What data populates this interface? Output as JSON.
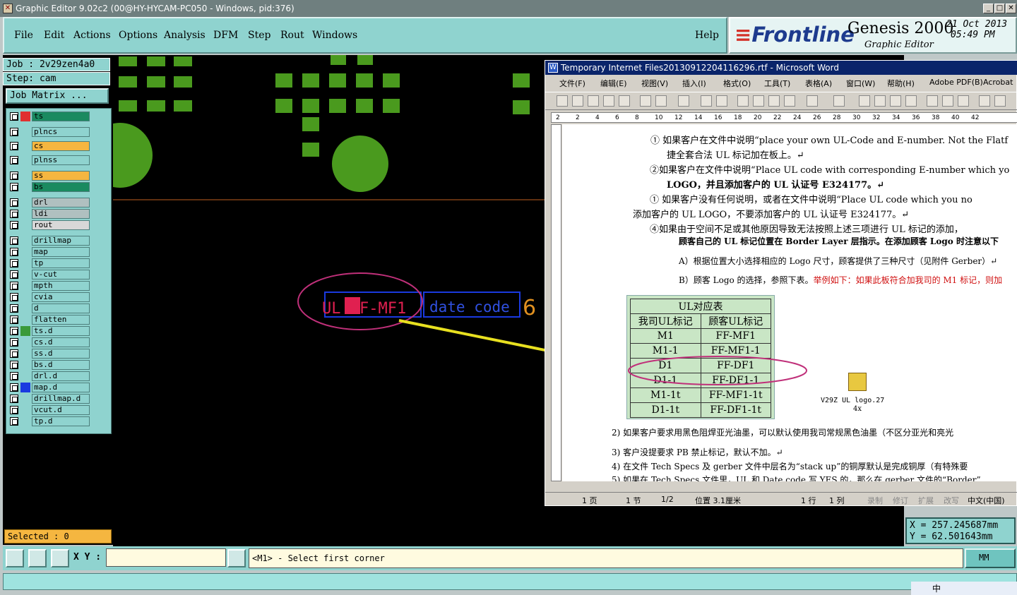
{
  "titlebar": {
    "title": "Graphic Editor 9.02c2 (00@HY-HYCAM-PC050 - Windows, pid:376)",
    "icon": "app-icon"
  },
  "menu": {
    "items": [
      "File",
      "Edit",
      "Actions",
      "Options",
      "Analysis",
      "DFM",
      "Step",
      "Rout",
      "Windows"
    ],
    "help": "Help"
  },
  "brand": {
    "logo": "Frontline",
    "product": "Genesis 2000",
    "subtitle": "Graphic Editor",
    "date": "21 Oct 2013",
    "time": "05:49 PM"
  },
  "job": {
    "job_field": "Job : 2v29zen4a0",
    "step_field": "Step: cam",
    "matrix_button": "Job Matrix ..."
  },
  "layers": [
    {
      "name": "ts",
      "color": "#1a8a60",
      "swatch": "#e03030",
      "active": true
    },
    {
      "name": "plncs",
      "color": "#8fd3cf"
    },
    {
      "name": "cs",
      "color": "#f5b640"
    },
    {
      "name": "plnss",
      "color": "#8fd3cf"
    },
    {
      "name": "ss",
      "color": "#f5b640"
    },
    {
      "name": "bs",
      "color": "#1a8a60"
    },
    {
      "name": "drl",
      "color": "#b0c0c0"
    },
    {
      "name": "ldi",
      "color": "#b0c0c0"
    },
    {
      "name": "rout",
      "color": "#d8d8d8"
    },
    {
      "name": "drillmap",
      "color": "#8fd3cf"
    },
    {
      "name": "map",
      "color": "#8fd3cf"
    },
    {
      "name": "tp",
      "color": "#8fd3cf"
    },
    {
      "name": "v-cut",
      "color": "#8fd3cf"
    },
    {
      "name": "mpth",
      "color": "#8fd3cf"
    },
    {
      "name": "cvia",
      "color": "#8fd3cf"
    },
    {
      "name": "d",
      "color": "#8fd3cf"
    },
    {
      "name": "flatten",
      "color": "#8fd3cf"
    },
    {
      "name": "ts.d",
      "color": "#8fd3cf",
      "swatch": "#3a9a3a"
    },
    {
      "name": "cs.d",
      "color": "#8fd3cf"
    },
    {
      "name": "ss.d",
      "color": "#8fd3cf"
    },
    {
      "name": "bs.d",
      "color": "#8fd3cf"
    },
    {
      "name": "drl.d",
      "color": "#8fd3cf"
    },
    {
      "name": "map.d",
      "color": "#8fd3cf",
      "swatch": "#1a3ae0"
    },
    {
      "name": "drillmap.d",
      "color": "#8fd3cf"
    },
    {
      "name": "vcut.d",
      "color": "#8fd3cf"
    },
    {
      "name": "tp.d",
      "color": "#8fd3cf"
    }
  ],
  "selected": "Selected : 0",
  "canvas": {
    "ul_text": "UL FF-MF1",
    "date_text": "date code",
    "digit": "6"
  },
  "word": {
    "title": "Temporary Internet Files20130912204116296.rtf - Microsoft Word",
    "menu": [
      "文件(F)",
      "编辑(E)",
      "视图(V)",
      "插入(I)",
      "格式(O)",
      "工具(T)",
      "表格(A)",
      "窗口(W)",
      "帮助(H)",
      "Adobe PDF(B)",
      "Acrobat"
    ],
    "ruler_ticks": [
      "2",
      "2",
      "4",
      "6",
      "8",
      "10",
      "12",
      "14",
      "16",
      "18",
      "20",
      "22",
      "24",
      "26",
      "28",
      "30",
      "32",
      "34",
      "36",
      "38",
      "40",
      "42"
    ],
    "lines": [
      "①  如果客户在文件中说明“place your own UL-Code and E-number. Not the Flatf",
      "捷全套合法 UL 标记加在板上。↵",
      "②如果客户在文件中说明“Place UL code with corresponding E-number which yo",
      "LOGO，并且添加客户的 UL 认证号 E324177。↵",
      "①    如果客户没有任何说明，或者在文件中说明“Place UL code which you no",
      "添加客户的 UL LOGO，不要添加客户的 UL 认证号 E324177。↵",
      "④如果由于空间不足或其他原因导致无法按照上述三项进行 UL 标记的添加，",
      "顾客自己的 UL 标记位置在 Border  Layer 层指示。在添加顾客 Logo 时注意以下",
      "A）根据位置大小选择相应的 Logo 尺寸，顾客提供了三种尺寸（见附件 Gerber）↵",
      "B）顾客 Logo 的选择，参照下表。",
      "举例如下：如果此板符合加我司的 M1 标记，则加",
      "2)  如果客户要求用黑色阻焊亚光油墨，可以默认使用我司常规黑色油墨（不区分亚光和亮光",
      "3)  客户没提要求 PB 禁止标记，默认不加。↵",
      "4)  在文件 Tech Specs 及 gerber 文件中层名为“stack up”的铜厚默认是完成铜厚（有特殊要",
      "5)  如果在 Tech Specs 文件里，UL 和 Date code 写 YES 的，那么在 gerber 文件的“Border”"
    ],
    "table": {
      "title": "UL对应表",
      "headers": [
        "我司UL标记",
        "顾客UL标记"
      ],
      "rows": [
        [
          "M1",
          "FF-MF1"
        ],
        [
          "M1-1",
          "FF-MF1-1"
        ],
        [
          "D1",
          "FF-DF1"
        ],
        [
          "D1-1",
          "FF-DF1-1"
        ],
        [
          "M1-1t",
          "FF-MF1-1t"
        ],
        [
          "D1-1t",
          "FF-DF1-1t"
        ]
      ]
    },
    "attachment": {
      "label": "V29Z  UL  logo.27",
      "sub": "4x"
    },
    "status": [
      "1 页",
      "1 节",
      "1/2",
      "位置 3.1厘米",
      "1 行",
      "1 列",
      "录制",
      "修订",
      "扩展",
      "改写",
      "中文(中国)"
    ]
  },
  "coords": {
    "x": "X  =  257.245687mm",
    "y": "Y  =  62.501643mm"
  },
  "command": {
    "xy_label": "X Y :",
    "xy_value": "",
    "prompt": "<M1> - Select first corner",
    "units": "MM"
  },
  "tray": {
    "text": "中"
  }
}
